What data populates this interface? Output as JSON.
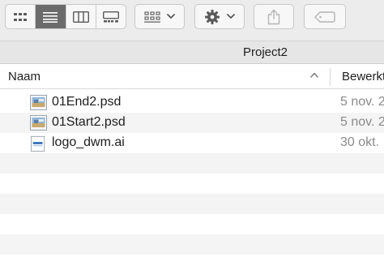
{
  "toolbar": {
    "view_modes": [
      "icon-view",
      "list-view",
      "column-view",
      "gallery-view"
    ],
    "active_view": "list-view",
    "group_icon": "group-grid-icon",
    "action_icon": "gear-icon",
    "share_icon": "share-icon",
    "tag_icon": "tag-icon"
  },
  "path": {
    "title": "Project2"
  },
  "columns": {
    "name": "Naam",
    "date": "Bewerkt"
  },
  "files": [
    {
      "name": "01End2.psd",
      "date": "5 nov. 2",
      "icon": "psd-file-icon"
    },
    {
      "name": "01Start2.psd",
      "date": "5 nov. 2",
      "icon": "psd-file-icon"
    },
    {
      "name": "logo_dwm.ai",
      "date": "30 okt.",
      "icon": "ai-file-icon"
    }
  ]
}
